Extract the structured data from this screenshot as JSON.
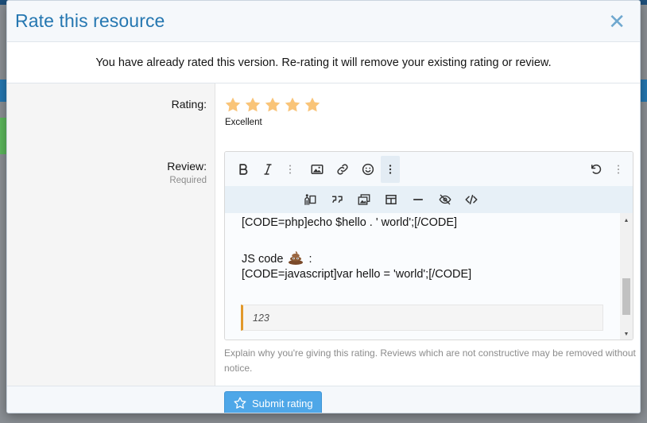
{
  "dialog": {
    "title": "Rate this resource",
    "close_glyph": "✕",
    "notice": "You have already rated this version. Re-rating it will remove your existing rating or review."
  },
  "rating": {
    "label": "Rating:",
    "value": 5,
    "max": 5,
    "text": "Excellent",
    "star_color": "#f9c478"
  },
  "review": {
    "label": "Review:",
    "hint": "Required",
    "toolbar_row1": [
      "bold-icon",
      "italic-icon",
      "more-text-options-icon",
      "image-icon",
      "link-icon",
      "smilie-icon",
      "more-options-icon",
      "undo-icon",
      "more-vertical-icon"
    ],
    "toolbar_row2": [
      "media-icon",
      "quote-icon",
      "gallery-icon",
      "table-icon",
      "horizontal-rule-icon",
      "spoiler-icon",
      "code-icon"
    ],
    "content": {
      "line1": "[CODE=php]echo $hello . ' world';[/CODE]",
      "line2_prefix": "JS code",
      "line2_suffix": ":",
      "line3": "[CODE=javascript]var hello = 'world';[/CODE]",
      "quote": "123"
    },
    "explain": "Explain why you're giving this rating. Reviews which are not constructive may be removed without notice."
  },
  "footer": {
    "submit_label": "Submit rating"
  },
  "colors": {
    "title": "#2577b1",
    "submit_bg": "#4ea7e8",
    "quote_border": "#e2992b"
  }
}
